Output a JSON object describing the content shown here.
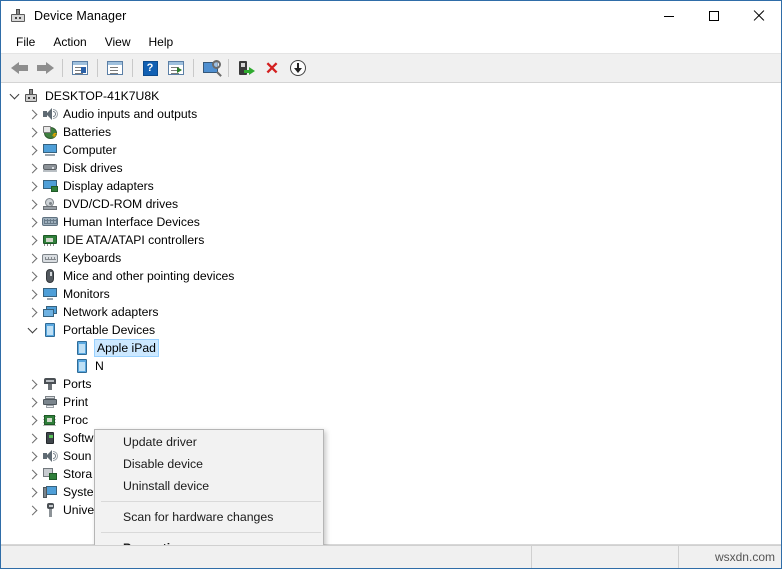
{
  "window": {
    "title": "Device Manager",
    "icon": "device-manager-icon",
    "controls": {
      "minimize": "minimize-button",
      "maximize": "maximize-button",
      "close": "close-button"
    }
  },
  "menubar": {
    "items": [
      {
        "label": "File"
      },
      {
        "label": "Action"
      },
      {
        "label": "View"
      },
      {
        "label": "Help"
      }
    ]
  },
  "toolbar": {
    "buttons": [
      {
        "name": "back-button",
        "icon": "back-arrow-icon"
      },
      {
        "name": "forward-button",
        "icon": "forward-arrow-icon"
      },
      {
        "name": "show-hide-console-tree-button",
        "icon": "console-tree-icon"
      },
      {
        "name": "properties-button",
        "icon": "properties-icon"
      },
      {
        "name": "help-button",
        "icon": "question-mark-icon"
      },
      {
        "name": "update-driver-toolbar-button",
        "icon": "update-driver-icon"
      },
      {
        "name": "scan-for-hardware-changes-button",
        "icon": "scan-hardware-icon"
      },
      {
        "name": "install-legacy-hardware-button",
        "icon": "install-driver-icon"
      },
      {
        "name": "uninstall-device-button",
        "icon": "red-x-icon"
      },
      {
        "name": "disable-device-button",
        "icon": "down-arrow-circle-icon"
      }
    ]
  },
  "tree": {
    "root": {
      "label": "DESKTOP-41K7U8K",
      "icon": "computer-root-icon",
      "expanded": true
    },
    "nodes": [
      {
        "label": "Audio inputs and outputs",
        "icon": "speaker-icon",
        "expanded": false,
        "indent": 1
      },
      {
        "label": "Batteries",
        "icon": "battery-icon",
        "expanded": false,
        "indent": 1
      },
      {
        "label": "Computer",
        "icon": "computer-icon",
        "expanded": false,
        "indent": 1
      },
      {
        "label": "Disk drives",
        "icon": "disk-drive-icon",
        "expanded": false,
        "indent": 1
      },
      {
        "label": "Display adapters",
        "icon": "display-adapter-icon",
        "expanded": false,
        "indent": 1
      },
      {
        "label": "DVD/CD-ROM drives",
        "icon": "dvd-drive-icon",
        "expanded": false,
        "indent": 1
      },
      {
        "label": "Human Interface Devices",
        "icon": "hid-icon",
        "expanded": false,
        "indent": 1
      },
      {
        "label": "IDE ATA/ATAPI controllers",
        "icon": "ide-controller-icon",
        "expanded": false,
        "indent": 1
      },
      {
        "label": "Keyboards",
        "icon": "keyboard-icon",
        "expanded": false,
        "indent": 1
      },
      {
        "label": "Mice and other pointing devices",
        "icon": "mouse-icon",
        "expanded": false,
        "indent": 1
      },
      {
        "label": "Monitors",
        "icon": "monitor-icon",
        "expanded": false,
        "indent": 1
      },
      {
        "label": "Network adapters",
        "icon": "network-adapter-icon",
        "expanded": false,
        "indent": 1
      },
      {
        "label": "Portable Devices",
        "icon": "portable-device-icon",
        "expanded": true,
        "indent": 1
      },
      {
        "label": "Apple iPad",
        "icon": "portable-device-icon",
        "expanded": false,
        "indent": 2,
        "selected": true,
        "leaf": true
      },
      {
        "label": "N",
        "icon": "portable-device-icon",
        "expanded": false,
        "indent": 2,
        "leaf": true,
        "occluded": true
      },
      {
        "label": "Ports",
        "icon": "port-icon",
        "expanded": false,
        "indent": 1,
        "occluded": true
      },
      {
        "label": "Print",
        "icon": "printer-icon",
        "expanded": false,
        "indent": 1,
        "occluded": true
      },
      {
        "label": "Proc",
        "icon": "processor-icon",
        "expanded": false,
        "indent": 1,
        "occluded": true
      },
      {
        "label": "Softw",
        "icon": "software-device-icon",
        "expanded": false,
        "indent": 1,
        "occluded": true
      },
      {
        "label": "Soun",
        "icon": "speaker-icon",
        "expanded": false,
        "indent": 1,
        "occluded": true
      },
      {
        "label": "Stora",
        "icon": "storage-controller-icon",
        "expanded": false,
        "indent": 1,
        "occluded": true
      },
      {
        "label": "System devices",
        "icon": "system-device-icon",
        "expanded": false,
        "indent": 1
      },
      {
        "label": "Universal Serial Bus controllers",
        "icon": "usb-controller-icon",
        "expanded": false,
        "indent": 1
      }
    ]
  },
  "context_menu": {
    "items": [
      {
        "label": "Update driver",
        "bold": false,
        "separator_after": false
      },
      {
        "label": "Disable device",
        "bold": false,
        "separator_after": false
      },
      {
        "label": "Uninstall device",
        "bold": false,
        "separator_after": true
      },
      {
        "label": "Scan for hardware changes",
        "bold": false,
        "separator_after": true
      },
      {
        "label": "Properties",
        "bold": true,
        "separator_after": false
      }
    ]
  },
  "statusbar": {
    "pane1": "",
    "pane2": "",
    "watermark": "wsxdn.com"
  },
  "colors": {
    "selection": "#cce8ff",
    "window_border": "#2f6da8",
    "toolbar_bg": "#f0f0f0",
    "menu_bg": "#f2f2f2",
    "accent_red": "#d32020",
    "accent_green": "#2faa2f"
  }
}
